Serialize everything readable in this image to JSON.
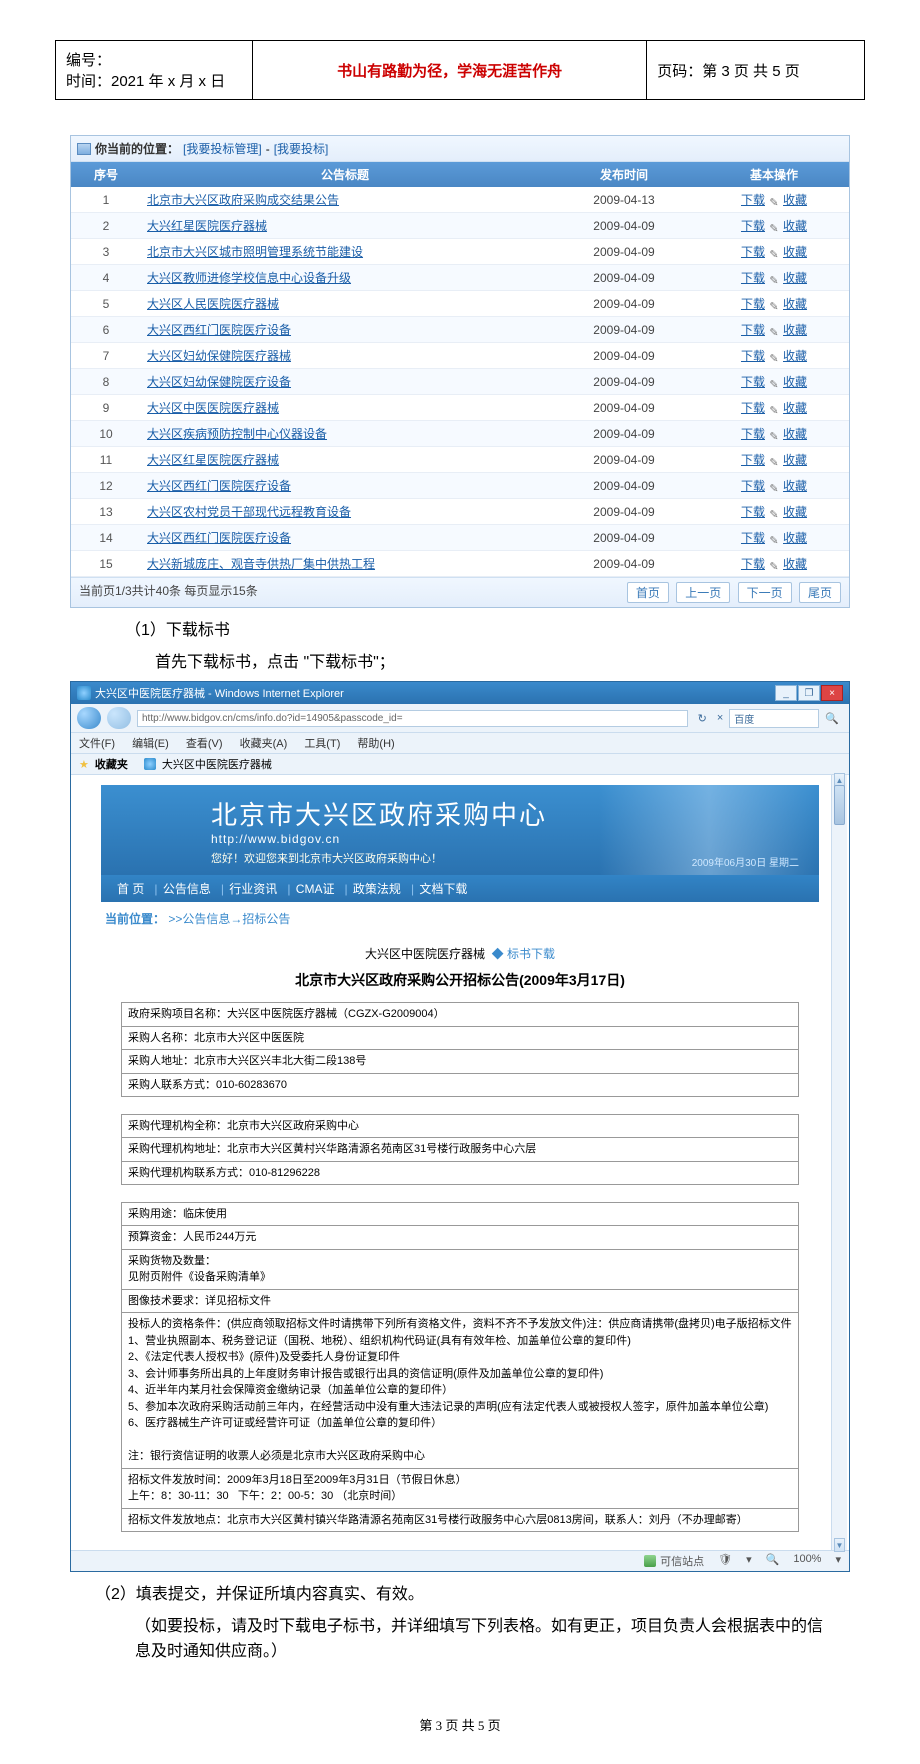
{
  "header": {
    "doc_id_label": "编号：",
    "time_label": "时间：2021 年 x 月 x 日",
    "motto": "书山有路勤为径，学海无涯苦作舟",
    "page_label": "页码：第 3 页 共 5 页"
  },
  "location": {
    "prefix": "你当前的位置：",
    "path1": "[我要投标管理]",
    "path2": "[我要投标]"
  },
  "list_headers": {
    "seq": "序号",
    "title": "公告标题",
    "date": "发布时间",
    "ops": "基本操作"
  },
  "op_labels": {
    "download": "下载",
    "favorite": "收藏"
  },
  "rows": [
    {
      "n": "1",
      "t": "北京市大兴区政府采购成交结果公告",
      "d": "2009-04-13"
    },
    {
      "n": "2",
      "t": "大兴红星医院医疗器械",
      "d": "2009-04-09"
    },
    {
      "n": "3",
      "t": "北京市大兴区城市照明管理系统节能建设",
      "d": "2009-04-09"
    },
    {
      "n": "4",
      "t": "大兴区教师进修学校信息中心设备升级",
      "d": "2009-04-09"
    },
    {
      "n": "5",
      "t": "大兴区人民医院医疗器械",
      "d": "2009-04-09"
    },
    {
      "n": "6",
      "t": "大兴区西红门医院医疗设备",
      "d": "2009-04-09"
    },
    {
      "n": "7",
      "t": "大兴区妇幼保健院医疗器械",
      "d": "2009-04-09"
    },
    {
      "n": "8",
      "t": "大兴区妇幼保健院医疗设备",
      "d": "2009-04-09"
    },
    {
      "n": "9",
      "t": "大兴区中医医院医疗器械",
      "d": "2009-04-09"
    },
    {
      "n": "10",
      "t": "大兴区疾病预防控制中心仪器设备",
      "d": "2009-04-09"
    },
    {
      "n": "11",
      "t": "大兴区红星医院医疗器械",
      "d": "2009-04-09"
    },
    {
      "n": "12",
      "t": "大兴区西红门医院医疗设备",
      "d": "2009-04-09"
    },
    {
      "n": "13",
      "t": "大兴区农村党员干部现代远程教育设备",
      "d": "2009-04-09"
    },
    {
      "n": "14",
      "t": "大兴区西红门医院医疗设备",
      "d": "2009-04-09"
    },
    {
      "n": "15",
      "t": "大兴新城庞庄、观音寺供热厂集中供热工程",
      "d": "2009-04-09"
    }
  ],
  "pager": {
    "info": "当前页1/3共计40条  每页显示15条",
    "first": "首页",
    "prev": "上一页",
    "next": "下一页",
    "last": "尾页"
  },
  "step1_label": "（1）下载标书",
  "step1_desc": "首先下载标书，点击 \"下载标书\"；",
  "ie": {
    "title": "大兴区中医院医疗器械 - Windows Internet Explorer",
    "url": "http://www.bidgov.cn/cms/info.do?id=14905&passcode_id=",
    "search_hint": "百度",
    "menu": {
      "file": "文件(F)",
      "edit": "编辑(E)",
      "view": "查看(V)",
      "fav": "收藏夹(A)",
      "tool": "工具(T)",
      "help": "帮助(H)"
    },
    "fav_label": "收藏夹",
    "fav_item": "大兴区中医院医疗器械",
    "status_trust": "可信站点",
    "status_zoom": "100%"
  },
  "site": {
    "title": "北京市大兴区政府采购中心",
    "url": "http://www.bidgov.cn",
    "welcome": "您好！欢迎您来到北京市大兴区政府采购中心！",
    "date": "2009年06月30日 星期二",
    "nav": {
      "home": "首 页",
      "info": "公告信息",
      "qual": "行业资讯",
      "cma": "CMA证",
      "policy": "政策法规",
      "download": "文档下载"
    },
    "crumb_prefix": "当前位置：",
    "crumb_path": ">>公告信息→招标公告"
  },
  "notice": {
    "head_left": "大兴区中医院医疗器械",
    "head_right": "标书下载",
    "title": "北京市大兴区政府采购公开招标公告(2009年3月17日)",
    "cells": [
      "政府采购项目名称：大兴区中医院医疗器械（CGZX-G2009004）",
      "采购人名称：北京市大兴区中医医院",
      "采购人地址：北京市大兴区兴丰北大街二段138号",
      "采购人联系方式：010-60283670",
      "",
      "采购代理机构全称：北京市大兴区政府采购中心",
      "采购代理机构地址：北京市大兴区黄村兴华路清源名苑南区31号楼行政服务中心六层",
      "采购代理机构联系方式：010-81296228",
      "",
      "采购用途：临床使用",
      "预算资金：人民币244万元",
      "采购货物及数量：\n见附页附件《设备采购清单》",
      "图像技术要求：详见招标文件",
      "投标人的资格条件：(供应商领取招标文件时请携带下列所有资格文件，资料不齐不予发放文件)注：供应商请携带(盘拷贝)电子版招标文件\n1、营业执照副本、税务登记证（国税、地税）、组织机构代码证(具有有效年检、加盖单位公章的复印件)\n2、《法定代表人授权书》(原件)及受委托人身份证复印件\n3、会计师事务所出具的上年度财务审计报告或银行出具的资信证明(原件及加盖单位公章的复印件)\n4、近半年内某月社会保障资金缴纳记录（加盖单位公章的复印件）\n5、参加本次政府采购活动前三年内，在经营活动中没有重大违法记录的声明(应有法定代表人或被授权人签字，原件加盖本单位公章)\n6、医疗器械生产许可证或经营许可证（加盖单位公章的复印件）\n\n注：银行资信证明的收票人必须是北京市大兴区政府采购中心",
      "招标文件发放时间：2009年3月18日至2009年3月31日（节假日休息）\n上午：8：30-11：30   下午：2：00-5：30 （北京时间）",
      "招标文件发放地点：北京市大兴区黄村镇兴华路清源名苑南区31号楼行政服务中心六层0813房间，联系人：刘丹（不办理邮寄）"
    ]
  },
  "step2_label": "（2）填表提交，并保证所填内容真实、有效。",
  "step2_desc": "（如要投标，请及时下载电子标书，并详细填写下列表格。如有更正，项目负责人会根据表中的信息及时通知供应商。）",
  "footer": "第 3 页 共 5 页"
}
